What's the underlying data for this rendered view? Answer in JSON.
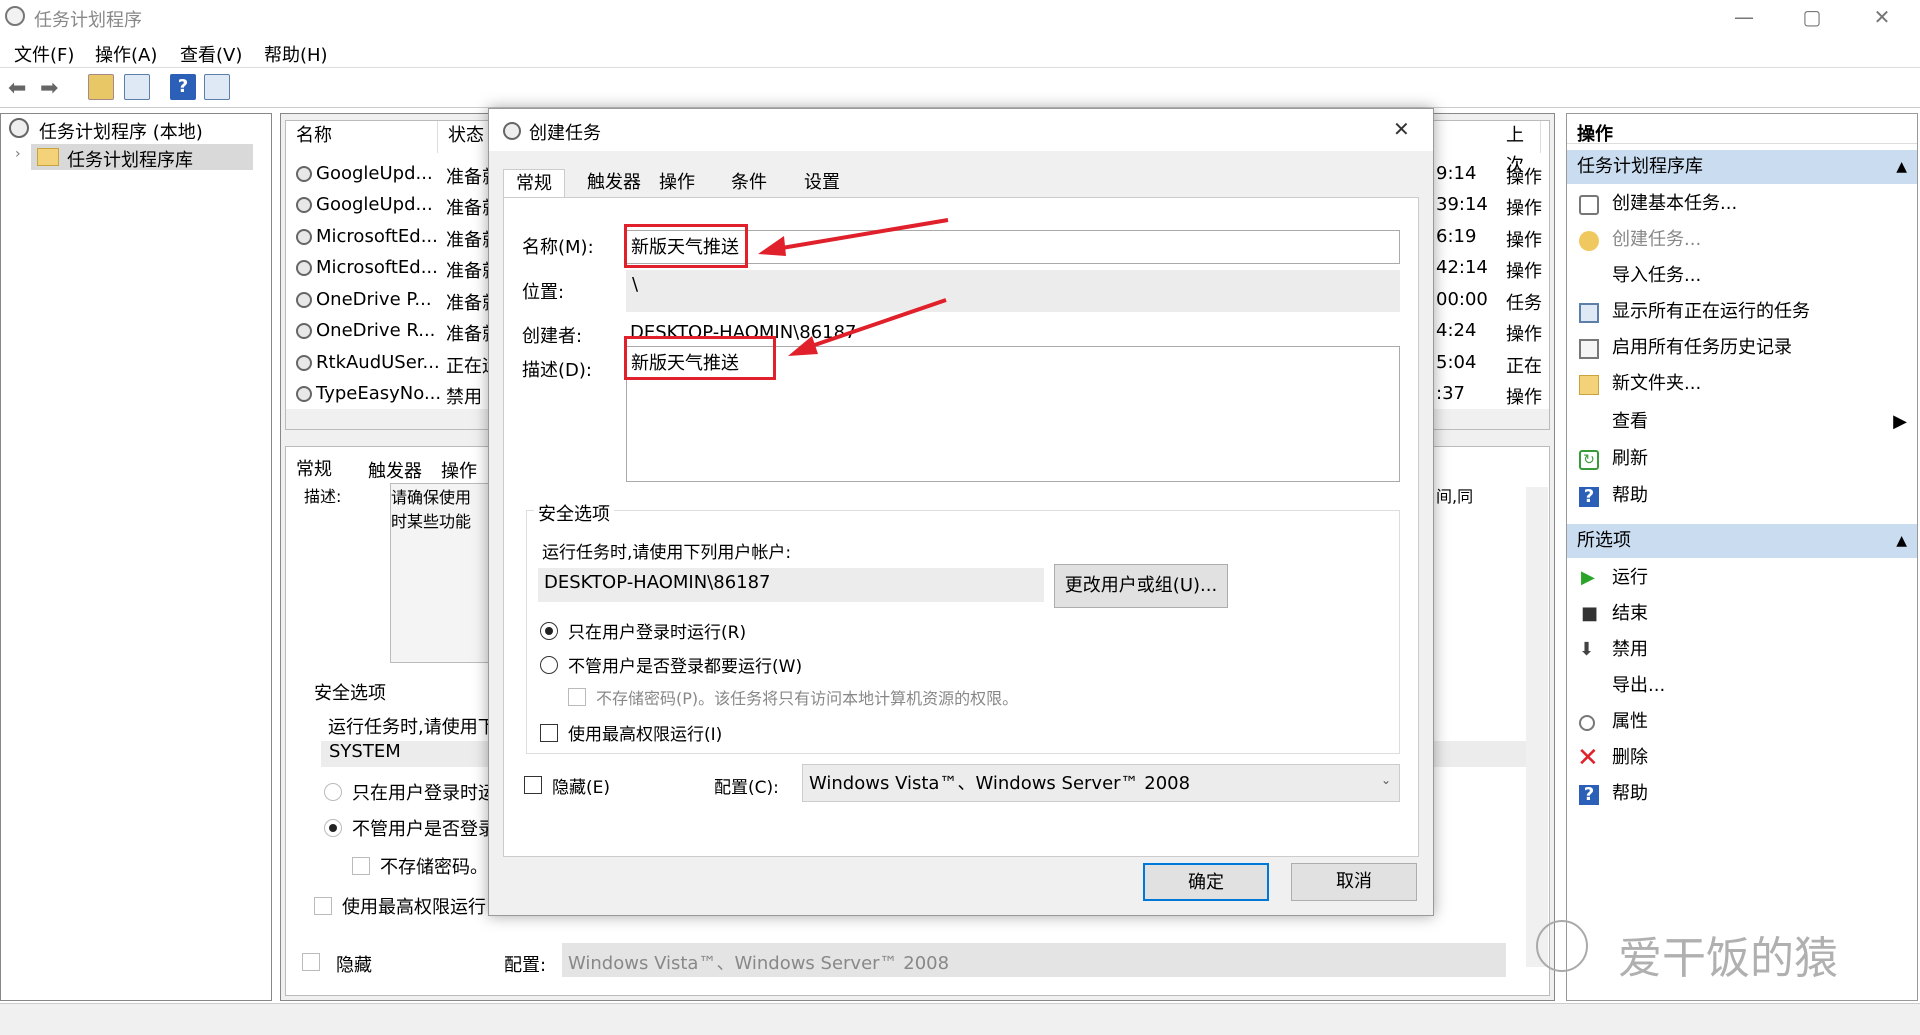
{
  "app": {
    "title": "任务计划程序"
  },
  "window_controls": {
    "minimize": "—",
    "maximize": "▢",
    "close": "✕"
  },
  "menu": [
    "文件(F)",
    "操作(A)",
    "查看(V)",
    "帮助(H)"
  ],
  "tree": {
    "root": "任务计划程序 (本地)",
    "child": "任务计划程序库"
  },
  "table": {
    "headers": [
      "名称",
      "状态",
      "上次"
    ],
    "rows": [
      {
        "name": "GoogleUpd...",
        "status": "准备就",
        "time": "9:14",
        "result": "操作"
      },
      {
        "name": "GoogleUpd...",
        "status": "准备就",
        "time": "39:14",
        "result": "操作"
      },
      {
        "name": "MicrosoftEd...",
        "status": "准备就",
        "time": "6:19",
        "result": "操作"
      },
      {
        "name": "MicrosoftEd...",
        "status": "准备就",
        "time": "42:14",
        "result": "操作"
      },
      {
        "name": "OneDrive P...",
        "status": "准备就",
        "time": "00:00",
        "result": "任务"
      },
      {
        "name": "OneDrive R...",
        "status": "准备就",
        "time": "4:24",
        "result": "操作"
      },
      {
        "name": "RtkAudUSer...",
        "status": "正在运",
        "time": "5:04",
        "result": "正在"
      },
      {
        "name": "TypeEasyNo...",
        "status": "禁用",
        "time": ":37",
        "result": "操作"
      }
    ]
  },
  "detail_bg": {
    "tabs": [
      "常规",
      "触发器",
      "操作"
    ],
    "desc_label": "描述:",
    "desc_text": "请确保使用\n时某些功能",
    "desc_right": "间,同",
    "security": "安全选项",
    "run_as": "运行任务时,请使用下",
    "account": "SYSTEM",
    "opt1": "只在用户登录时运",
    "opt2": "不管用户是否登录",
    "opt3": "不存储密码。该",
    "opt4": "使用最高权限运行",
    "hidden": "隐藏",
    "config_label": "配置:",
    "config_value": "Windows Vista™、Windows Server™ 2008"
  },
  "dialog": {
    "title": "创建任务",
    "close": "✕",
    "tabs": [
      "常规",
      "触发器",
      "操作",
      "条件",
      "设置"
    ],
    "name_label": "名称(M):",
    "name_value": "新版天气推送",
    "location_label": "位置:",
    "location_value": "\\",
    "author_label": "创建者:",
    "author_value": "DESKTOP-HAOMIN\\86187",
    "desc_label": "描述(D):",
    "desc_value": "新版天气推送",
    "security_title": "安全选项",
    "run_as_text": "运行任务时,请使用下列用户帐户:",
    "account": "DESKTOP-HAOMIN\\86187",
    "change_user_btn": "更改用户或组(U)...",
    "radio1": "只在用户登录时运行(R)",
    "radio2": "不管用户是否登录都要运行(W)",
    "no_store_pw": "不存储密码(P)。该任务将只有访问本地计算机资源的权限。",
    "highest": "使用最高权限运行(I)",
    "hidden": "隐藏(E)",
    "config_label": "配置(C):",
    "config_value": "Windows Vista™、Windows Server™ 2008",
    "ok": "确定",
    "cancel": "取消"
  },
  "actions": {
    "header": "操作",
    "section1": "任务计划程序库",
    "items1": [
      "创建基本任务...",
      "创建任务...",
      "导入任务...",
      "显示所有正在运行的任务",
      "启用所有任务历史记录",
      "新文件夹...",
      "查看",
      "刷新",
      "帮助"
    ],
    "section2": "所选项",
    "items2": [
      "运行",
      "结束",
      "禁用",
      "导出...",
      "属性",
      "删除",
      "帮助"
    ]
  },
  "watermark": "爱干饭的猿",
  "colors": {
    "accent_red": "#e0202a",
    "section_blue": "#c9dcf0",
    "ok_border": "#0078d7"
  }
}
